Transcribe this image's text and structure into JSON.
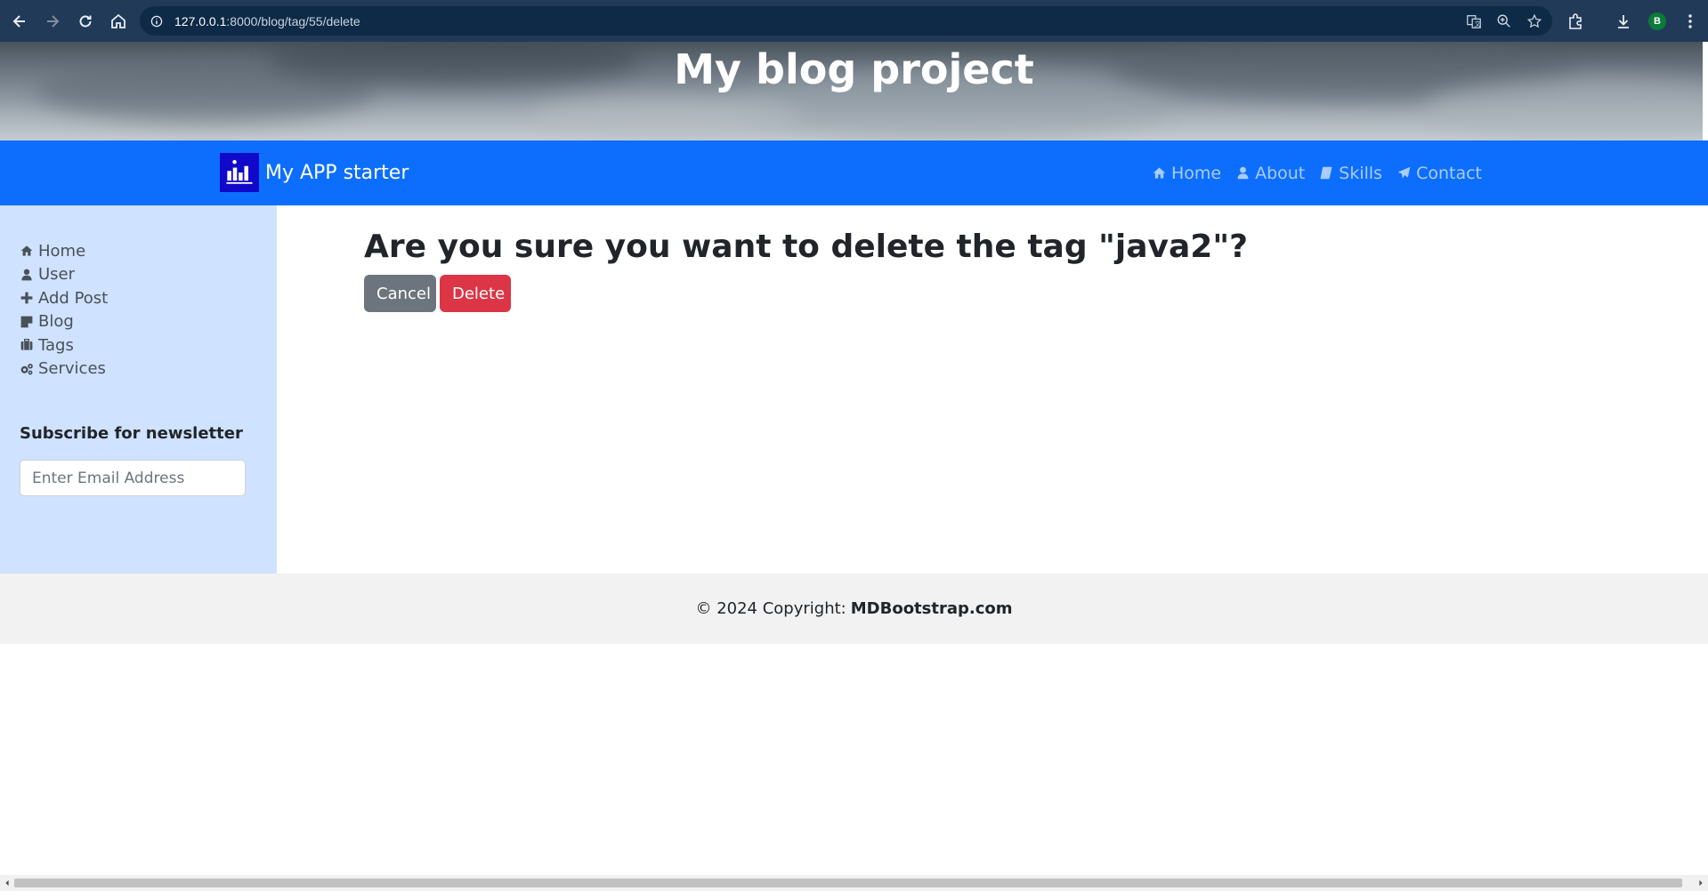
{
  "browser": {
    "url_host": "127.0.0.1",
    "url_rest": ":8000/blog/tag/55/delete",
    "profile_initial": "B"
  },
  "banner": {
    "title": "My blog project"
  },
  "navbar": {
    "brand": "My APP starter",
    "links": [
      {
        "label": "Home",
        "icon": "home-icon"
      },
      {
        "label": "About",
        "icon": "user-icon"
      },
      {
        "label": "Skills",
        "icon": "book-icon"
      },
      {
        "label": "Contact",
        "icon": "paper-plane-icon"
      }
    ]
  },
  "sidebar": {
    "items": [
      {
        "label": "Home",
        "icon": "home-icon"
      },
      {
        "label": "User",
        "icon": "user-icon"
      },
      {
        "label": "Add Post",
        "icon": "plus-icon"
      },
      {
        "label": "Blog",
        "icon": "sticky-note-icon"
      },
      {
        "label": "Tags",
        "icon": "briefcase-icon"
      },
      {
        "label": "Services",
        "icon": "cogs-icon"
      }
    ],
    "newsletter_title": "Subscribe for newsletter",
    "email_placeholder": "Enter Email Address"
  },
  "main": {
    "question": "Are you sure you want to delete the tag \"java2\"?",
    "cancel_label": "Cancel",
    "delete_label": "Delete"
  },
  "footer": {
    "copyright": "© 2024 Copyright:",
    "brand": "MDBootstrap.com"
  },
  "colors": {
    "navbar": "#0d6efd",
    "sidebar": "#cfe2ff",
    "cancel": "#6c757d",
    "delete": "#dc3545",
    "footer": "#f2f2f2"
  }
}
